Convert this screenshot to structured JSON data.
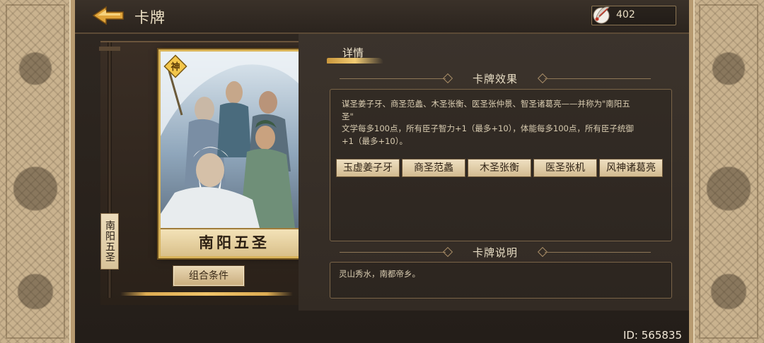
{
  "header": {
    "title": "卡牌",
    "currency_value": "402"
  },
  "card": {
    "name": "南阳五圣",
    "vertical_label": "南阳五圣",
    "combo_button_label": "组合条件"
  },
  "detail": {
    "tab_label": "详情",
    "effect_heading": "卡牌效果",
    "effect_line1": "谋圣姜子牙、商圣范蠡、木圣张衡、医圣张仲景、智圣诸葛亮——并称为\"南阳五圣\"",
    "effect_line2": "文学每多100点，所有臣子智力+1（最多+10），体能每多100点，所有臣子统御+1（最多+10）。",
    "chips": [
      "玉虚姜子牙",
      "商圣范蠡",
      "木圣张衡",
      "医圣张机",
      "风神诸葛亮"
    ],
    "description_heading": "卡牌说明",
    "description_text": "灵山秀水，南都帝乡。"
  },
  "footer": {
    "id_text": "ID: 565835"
  },
  "colors": {
    "accent_gold": "#d9b45a",
    "panel_dark": "#2f2822",
    "side_panel": "#c9b28e"
  },
  "icons": [
    "back-arrow-icon",
    "feather-coin-icon",
    "card-badge-icon"
  ]
}
